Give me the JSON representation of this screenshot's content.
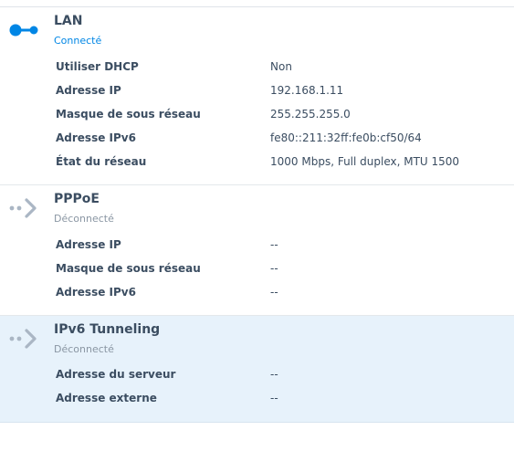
{
  "colors": {
    "connected": "#0086e5",
    "disconnected_icon": "#aab6c4",
    "label_text": "#3b4d61",
    "selected_row_bg": "#e7f2fb"
  },
  "interfaces": [
    {
      "name": "LAN",
      "status": "Connecté",
      "icon": "connected-link-icon",
      "properties": [
        {
          "label": "Utiliser DHCP",
          "value": "Non"
        },
        {
          "label": "Adresse IP",
          "value": "192.168.1.11"
        },
        {
          "label": "Masque de sous réseau",
          "value": "255.255.255.0"
        },
        {
          "label": "Adresse IPv6",
          "value": "fe80::211:32ff:fe0b:cf50/64"
        },
        {
          "label": "État du réseau",
          "value": "1000 Mbps, Full duplex, MTU 1500"
        }
      ]
    },
    {
      "name": "PPPoE",
      "status": "Déconnecté",
      "icon": "disconnected-arrow-icon",
      "properties": [
        {
          "label": "Adresse IP",
          "value": "--"
        },
        {
          "label": "Masque de sous réseau",
          "value": "--"
        },
        {
          "label": "Adresse IPv6",
          "value": "--"
        }
      ]
    },
    {
      "name": "IPv6 Tunneling",
      "status": "Déconnecté",
      "icon": "disconnected-arrow-icon",
      "properties": [
        {
          "label": "Adresse du serveur",
          "value": "--"
        },
        {
          "label": "Adresse externe",
          "value": "--"
        }
      ]
    }
  ]
}
